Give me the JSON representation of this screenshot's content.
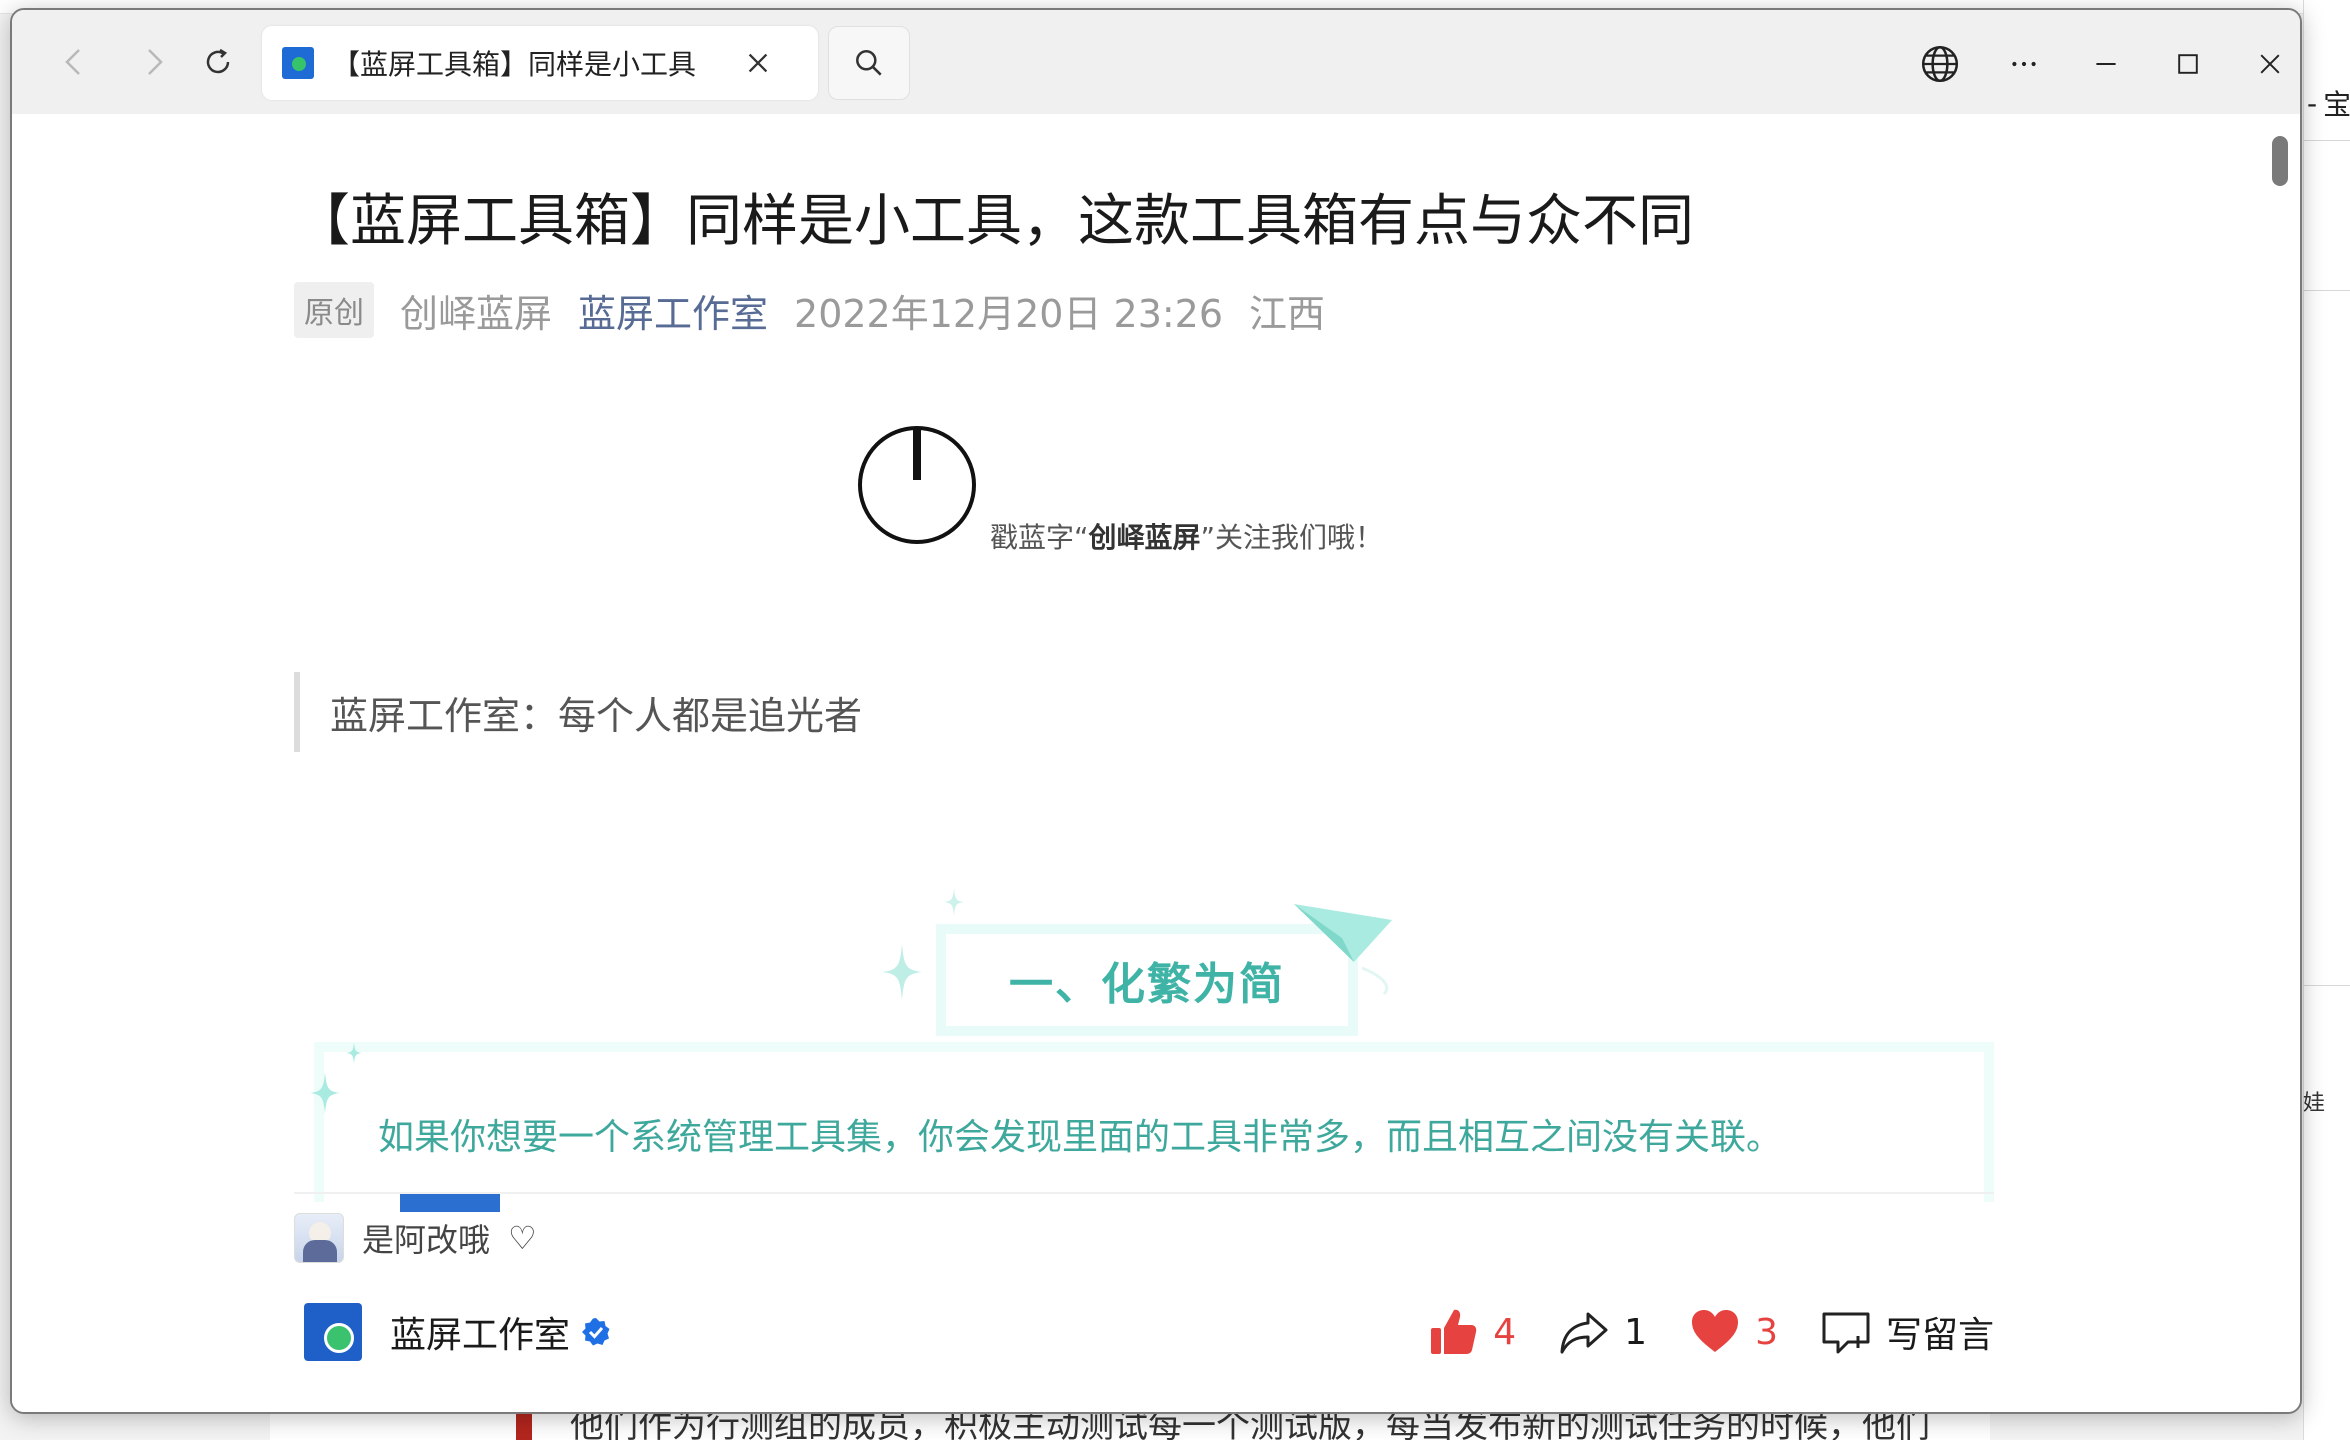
{
  "browser": {
    "tab_title": "【蓝屏工具箱】同样是小工具",
    "icons": {
      "back": "back-arrow-icon",
      "forward": "forward-arrow-icon",
      "refresh": "refresh-icon",
      "close_tab": "close-icon",
      "search": "search-icon",
      "globe": "globe-icon",
      "more": "more-icon",
      "minimize": "minimize-icon",
      "maximize": "maximize-icon",
      "close_window": "close-icon"
    }
  },
  "background": {
    "right_tab_label": "宝",
    "right_fragment": "娃",
    "bottom_text": "他们作为行测组的成员，积极主动测试每一个测试版，每当发布新的测试任务的时候，他们"
  },
  "article": {
    "title": "【蓝屏工具箱】同样是小工具，这款工具箱有点与众不同",
    "meta": {
      "tag": "原创",
      "author": "创峄蓝屏",
      "account": "蓝屏工作室",
      "date": "2022年12月20日 23:26",
      "location": "江西"
    },
    "follow": {
      "prefix": "戳蓝字“",
      "name": "创峄蓝屏",
      "suffix": "”关注我们哦！"
    },
    "quote": "蓝屏工作室：每个人都是追光者",
    "section_title": "一、化繁为简",
    "intro": "如果你想要一个系统管理工具集，你会发现里面的工具非常多，而且相互之间没有关联。"
  },
  "commenter": {
    "name": "是阿改哦",
    "heart": "♡"
  },
  "footer": {
    "account_name": "蓝屏工作室",
    "like_count": "4",
    "share_count": "1",
    "favorite_count": "3",
    "comment_label": "写留言"
  },
  "colors": {
    "accent_teal": "#3fb4a6",
    "account_link": "#576b95",
    "like_red": "#e64340"
  }
}
